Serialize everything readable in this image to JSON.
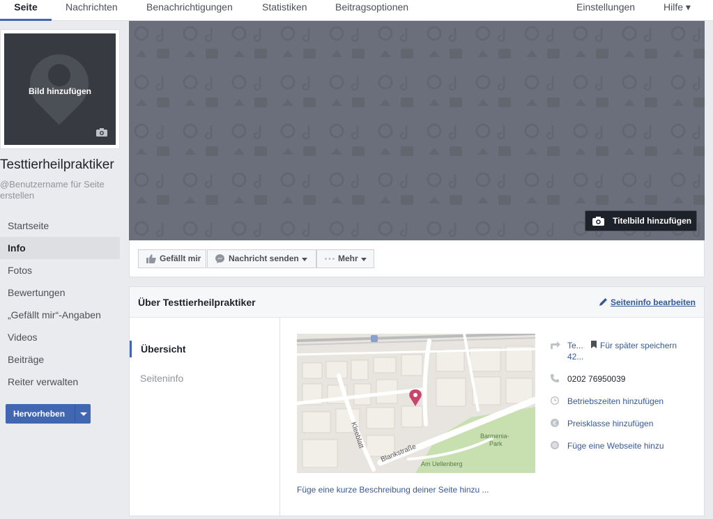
{
  "nav": {
    "tabs": [
      "Seite",
      "Nachrichten",
      "Benachrichtigungen",
      "Statistiken",
      "Beitragsoptionen"
    ],
    "settings": "Einstellungen",
    "help": "Hilfe ▾"
  },
  "profile": {
    "add_picture": "Bild hinzufügen",
    "page_name": "Testtierheilpraktiker",
    "username_hint": "@Benutzername für Seite erstellen"
  },
  "sidebar": {
    "items": [
      {
        "label": "Startseite",
        "active": false
      },
      {
        "label": "Info",
        "active": true
      },
      {
        "label": "Fotos",
        "active": false
      },
      {
        "label": "Bewertungen",
        "active": false
      },
      {
        "label": "„Gefällt mir“-Angaben",
        "active": false
      },
      {
        "label": "Videos",
        "active": false
      },
      {
        "label": "Beiträge",
        "active": false
      },
      {
        "label": "Reiter verwalten",
        "active": false
      }
    ],
    "promote": "Hervorheben"
  },
  "cover": {
    "add_cover": "Titelbild hinzufügen"
  },
  "actions": {
    "like": "Gefällt mir",
    "message": "Nachricht senden",
    "more": "Mehr"
  },
  "about": {
    "title": "Über Testtierheilpraktiker",
    "edit": "Seiteninfo bearbeiten",
    "tabs": [
      "Übersicht",
      "Seiteninfo"
    ],
    "address_line1": "Te...",
    "address_line2": "42...",
    "save_later": "Für später speichern",
    "phone": "0202 76950039",
    "hours": "Betriebszeiten hinzufügen",
    "price": "Preisklasse hinzufügen",
    "website": "Füge eine Webseite hinzu",
    "description": "Füge eine kurze Beschreibung deiner Seite hinzu ...",
    "map_labels": {
      "street1": "Kleeblatt",
      "street2": "Blankstraße",
      "park": "Barmenia-\nPark",
      "street3": "Am Uellenberg"
    }
  },
  "colors": {
    "brand": "#4267b2",
    "link": "#365899",
    "pin": "#c8466e",
    "park": "#c8dfb0"
  }
}
